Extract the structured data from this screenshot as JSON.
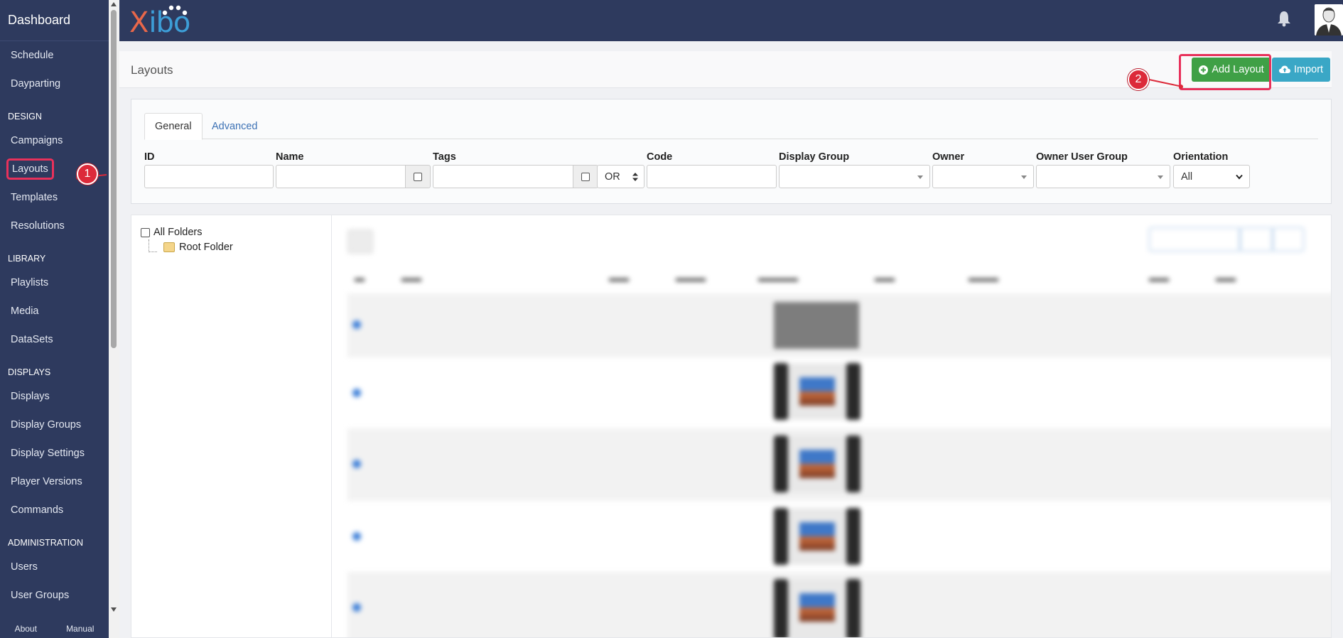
{
  "sidebar": {
    "brand": "Dashboard",
    "items": [
      {
        "type": "item",
        "label": "Schedule"
      },
      {
        "type": "item",
        "label": "Dayparting"
      },
      {
        "type": "section",
        "label": "DESIGN"
      },
      {
        "type": "item",
        "label": "Campaigns"
      },
      {
        "type": "item",
        "label": "Layouts",
        "highlighted": true
      },
      {
        "type": "item",
        "label": "Templates"
      },
      {
        "type": "item",
        "label": "Resolutions"
      },
      {
        "type": "section",
        "label": "LIBRARY"
      },
      {
        "type": "item",
        "label": "Playlists"
      },
      {
        "type": "item",
        "label": "Media"
      },
      {
        "type": "item",
        "label": "DataSets"
      },
      {
        "type": "section",
        "label": "DISPLAYS"
      },
      {
        "type": "item",
        "label": "Displays"
      },
      {
        "type": "item",
        "label": "Display Groups"
      },
      {
        "type": "item",
        "label": "Display Settings"
      },
      {
        "type": "item",
        "label": "Player Versions"
      },
      {
        "type": "item",
        "label": "Commands"
      },
      {
        "type": "section",
        "label": "ADMINISTRATION"
      },
      {
        "type": "item",
        "label": "Users"
      },
      {
        "type": "item",
        "label": "User Groups"
      }
    ],
    "footer": {
      "about": "About",
      "manual": "Manual"
    }
  },
  "topbar": {
    "logo_x": "X",
    "logo_rest": "ibo",
    "bell_icon": "bell-icon",
    "avatar_icon": "user-avatar"
  },
  "header": {
    "title": "Layouts",
    "add_label": "Add Layout",
    "import_label": "Import",
    "add_icon": "plus-circle-icon",
    "import_icon": "cloud-upload-icon"
  },
  "filter": {
    "tabs": [
      "General",
      "Advanced"
    ],
    "labels": {
      "id": "ID",
      "name": "Name",
      "tags": "Tags",
      "code": "Code",
      "display_group": "Display Group",
      "owner": "Owner",
      "owner_user_group": "Owner User Group",
      "orientation": "Orientation"
    },
    "tags_operator": "OR",
    "orientation_value": "All"
  },
  "folders": {
    "all": "All Folders",
    "root": "Root Folder"
  },
  "callouts": [
    "1",
    "2"
  ],
  "colors": {
    "sidebar_bg": "#2e3a5e",
    "add_button": "#3fa046",
    "import_button": "#3aa7c6",
    "highlight": "#e8315b",
    "callout": "#dc2a3a"
  }
}
